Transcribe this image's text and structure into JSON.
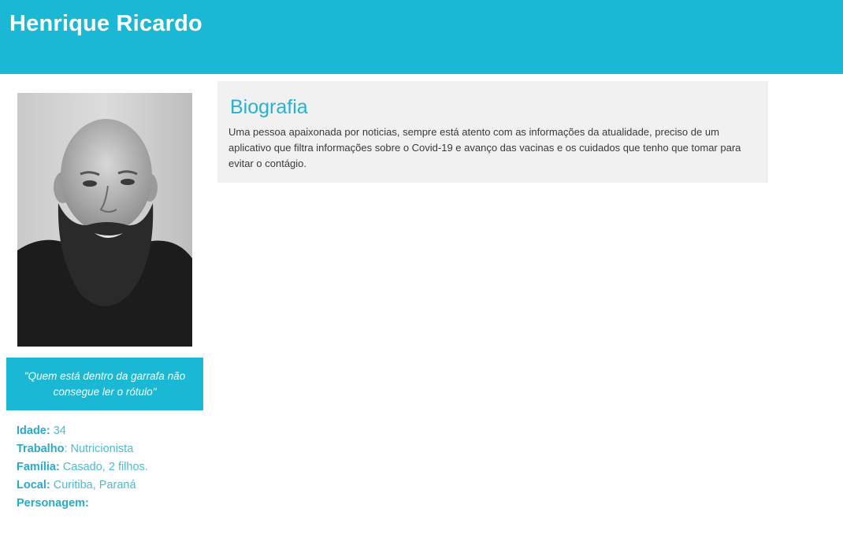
{
  "header": {
    "name": "Henrique Ricardo"
  },
  "profile": {
    "quote": "\"Quem está dentro da garrafa não consegue ler o rótulo\"",
    "facts": [
      {
        "label": "Idade:",
        "value": " 34"
      },
      {
        "label": "Trabalho",
        "value": ": Nutricionista"
      },
      {
        "label": "Família:",
        "value": " Casado, 2 filhos."
      },
      {
        "label": "Local:",
        "value": " Curitiba, Paraná"
      },
      {
        "label": "Personagem:",
        "value": ""
      }
    ]
  },
  "bio": {
    "title": "Biografia",
    "text": "Uma pessoa apaixonada por noticias, sempre está atento com as informações da atualidade, preciso de um aplicativo que filtra informações sobre o Covid-19 e avanço das vacinas e os cuidados que tenho que tomar para evitar o contágio."
  },
  "colors": {
    "accent": "#1ab8d5",
    "panel": "#f1f1f1",
    "text": "#3a3a3a"
  }
}
